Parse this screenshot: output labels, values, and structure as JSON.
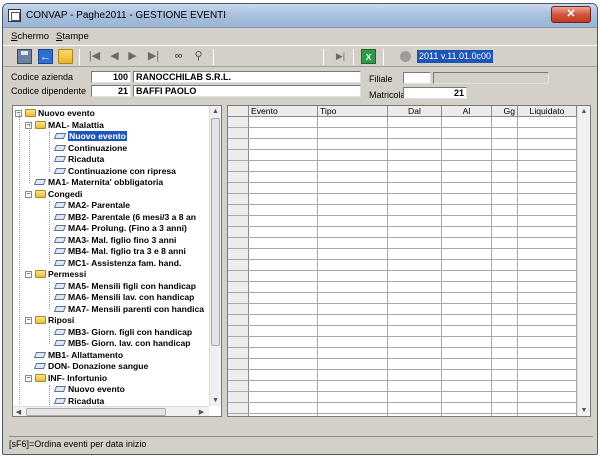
{
  "window": {
    "title": "CONVAP - Paghe2011 - GESTIONE EVENTI",
    "close_label": "✕"
  },
  "menu": [
    {
      "accel": "S",
      "rest": "chermo"
    },
    {
      "accel": "S",
      "rest": "tampe"
    }
  ],
  "toolbar": {
    "version": "2011 v.11.01.0c00",
    "excel_label": "X"
  },
  "header": {
    "codice_azienda_label": "Codice azienda",
    "codice_azienda_value": "100",
    "azienda_name": "RANOCCHILAB S.R.L.",
    "codice_dipendente_label": "Codice dipendente",
    "codice_dipendente_value": "21",
    "dipendente_name": "BAFFI PAOLO",
    "filiale_label": "Filiale",
    "filiale_value": "",
    "filiale_desc": "",
    "matricola_label": "Matricola",
    "matricola_value": "21"
  },
  "tree": [
    {
      "label": "Nuovo evento",
      "level": 0,
      "type": "folder",
      "expander": "−"
    },
    {
      "label": "MAL- Malattia",
      "level": 1,
      "type": "folder",
      "expander": "−"
    },
    {
      "label": "Nuovo evento",
      "level": 2,
      "type": "doc",
      "selected": true
    },
    {
      "label": "Continuazione",
      "level": 2,
      "type": "doc"
    },
    {
      "label": "Ricaduta",
      "level": 2,
      "type": "doc"
    },
    {
      "label": "Continuazione con ripresa",
      "level": 2,
      "type": "doc"
    },
    {
      "label": "MA1- Maternita' obbligatoria",
      "level": 1,
      "type": "doc"
    },
    {
      "label": "Congedi",
      "level": 1,
      "type": "folder",
      "expander": "−"
    },
    {
      "label": "MA2- Parentale",
      "level": 2,
      "type": "doc"
    },
    {
      "label": "MB2- Parentale (6 mesi/3 a 8 an",
      "level": 2,
      "type": "doc"
    },
    {
      "label": "MA4- Prolung. (Fino a 3 anni)",
      "level": 2,
      "type": "doc"
    },
    {
      "label": "MA3- Mal. figlio fino 3 anni",
      "level": 2,
      "type": "doc"
    },
    {
      "label": "MB4- Mal. figlio tra 3 e 8 anni",
      "level": 2,
      "type": "doc"
    },
    {
      "label": "MC1- Assistenza fam. hand.",
      "level": 2,
      "type": "doc"
    },
    {
      "label": "Permessi",
      "level": 1,
      "type": "folder",
      "expander": "−"
    },
    {
      "label": "MA5- Mensili figli con handicap",
      "level": 2,
      "type": "doc"
    },
    {
      "label": "MA6- Mensili lav. con handicap",
      "level": 2,
      "type": "doc"
    },
    {
      "label": "MA7- Mensili parenti con handica",
      "level": 2,
      "type": "doc"
    },
    {
      "label": "Riposi",
      "level": 1,
      "type": "folder",
      "expander": "−"
    },
    {
      "label": "MB3- Giorn. figli con handicap",
      "level": 2,
      "type": "doc"
    },
    {
      "label": "MB5- Giorn. lav. con handicap",
      "level": 2,
      "type": "doc"
    },
    {
      "label": "MB1- Allattamento",
      "level": 1,
      "type": "doc"
    },
    {
      "label": "DON- Donazione sangue",
      "level": 1,
      "type": "doc"
    },
    {
      "label": "INF- Infortunio",
      "level": 1,
      "type": "folder",
      "expander": "−"
    },
    {
      "label": "Nuovo evento",
      "level": 2,
      "type": "doc"
    },
    {
      "label": "Ricaduta",
      "level": 2,
      "type": "doc"
    }
  ],
  "grid": {
    "columns": [
      {
        "key": "evento",
        "label": "Evento"
      },
      {
        "key": "tipo",
        "label": "Tipo"
      },
      {
        "key": "dal",
        "label": "Dal"
      },
      {
        "key": "al",
        "label": "Al"
      },
      {
        "key": "gg",
        "label": "Gg"
      },
      {
        "key": "liquidato",
        "label": "Liquidato"
      }
    ]
  },
  "statusbar": {
    "text": "[sF6]=Ordina eventi per data inizio"
  }
}
